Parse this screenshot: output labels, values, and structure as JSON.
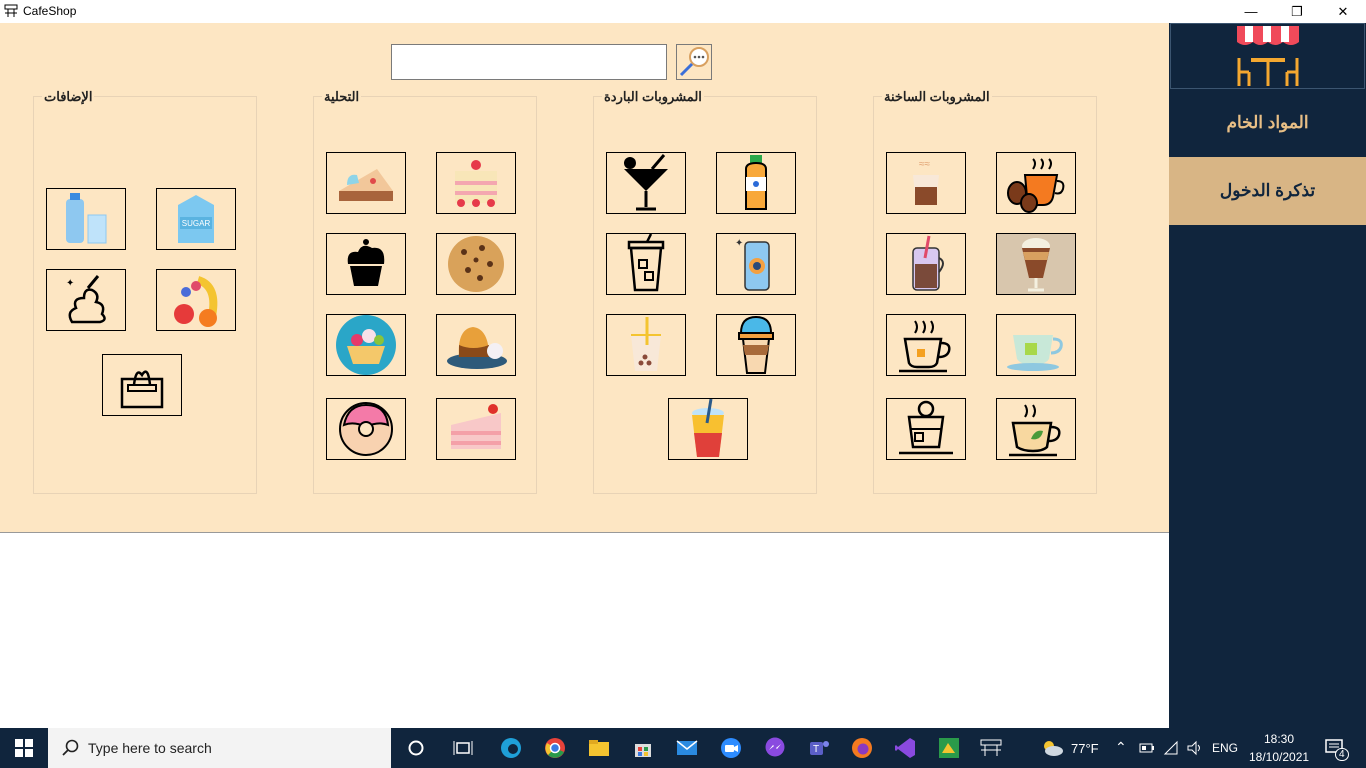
{
  "window": {
    "title": "CafeShop",
    "minimize": "—",
    "maximize": "❐",
    "close": "✕"
  },
  "search": {
    "value": "",
    "placeholder": ""
  },
  "groups": {
    "hot": {
      "title": "المشروبات الساخنة"
    },
    "cold": {
      "title": "المشروبات الباردة"
    },
    "dessert": {
      "title": "التحلية"
    },
    "additions": {
      "title": "الإضافات"
    }
  },
  "sidebar": {
    "raw_materials": "المواد الخام",
    "login_ticket": "تذكرة الدخول"
  },
  "taskbar": {
    "search_placeholder": "Type here to search",
    "weather": "77°F",
    "language": "ENG",
    "time": "18:30",
    "date": "18/10/2021",
    "notifications": "4"
  },
  "colors": {
    "main_bg": "#fde6c3",
    "sidebar_bg": "#10253d",
    "accent": "#d8b585"
  }
}
